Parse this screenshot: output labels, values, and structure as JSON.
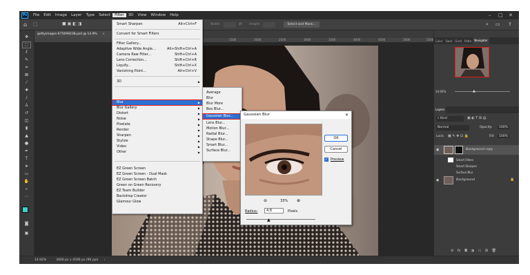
{
  "menubar": {
    "logo": "Ps",
    "items": [
      "File",
      "Edit",
      "Image",
      "Layer",
      "Type",
      "Select",
      "Filter",
      "3D",
      "View",
      "Window",
      "Help"
    ],
    "active_index": 6
  },
  "optbar": {
    "width_label": "Width:",
    "height_label": "Height:",
    "select_mask_label": "Select and Mask..."
  },
  "document": {
    "tab_title": "gettyimages-675699238.psd @ 14.9%",
    "ruler_ticks": [
      "1500",
      "2000",
      "2500",
      "3000",
      "3500",
      "4000",
      "4500",
      "5000",
      "5500"
    ],
    "zoom_status": "14.92%",
    "dimensions_status": "3000 px x 4500 px (96 ppi)"
  },
  "filter_menu": {
    "group1": [
      {
        "label": "Smart Sharpen",
        "shortcut": "Alt+Ctrl+F"
      }
    ],
    "group2": [
      {
        "label": "Convert for Smart Filters",
        "shortcut": ""
      }
    ],
    "group3": [
      {
        "label": "Filter Gallery...",
        "shortcut": ""
      },
      {
        "label": "Adaptive Wide Angle...",
        "shortcut": "Alt+Shift+Ctrl+A"
      },
      {
        "label": "Camera Raw Filter...",
        "shortcut": "Shift+Ctrl+A"
      },
      {
        "label": "Lens Correction...",
        "shortcut": "Shift+Ctrl+R"
      },
      {
        "label": "Liquify...",
        "shortcut": "Shift+Ctrl+X"
      },
      {
        "label": "Vanishing Point...",
        "shortcut": "Alt+Ctrl+V"
      }
    ],
    "group4": [
      {
        "label": "3D"
      }
    ],
    "group5": [
      {
        "label": "Blur"
      },
      {
        "label": "Blur Gallery"
      },
      {
        "label": "Distort"
      },
      {
        "label": "Noise"
      },
      {
        "label": "Pixelate"
      },
      {
        "label": "Render"
      },
      {
        "label": "Sharpen"
      },
      {
        "label": "Stylize"
      },
      {
        "label": "Video"
      },
      {
        "label": "Other"
      }
    ],
    "group6": [
      {
        "label": "EZ Green Screen"
      },
      {
        "label": "EZ Green Screen - Dual Mask"
      },
      {
        "label": "EZ Green Screen Batch"
      },
      {
        "label": "Green on Green Recovery"
      },
      {
        "label": "EZ Team Builder"
      },
      {
        "label": "Backdrop Creator"
      },
      {
        "label": "Glamour Glow"
      }
    ],
    "highlighted": "Blur"
  },
  "blur_menu": {
    "items": [
      "Average",
      "Blur",
      "Blur More",
      "Box Blur...",
      "Gaussian Blur...",
      "Lens Blur...",
      "Motion Blur...",
      "Radial Blur...",
      "Shape Blur...",
      "Smart Blur...",
      "Surface Blur..."
    ],
    "highlighted": "Gaussian Blur..."
  },
  "dialog": {
    "title": "Gaussian Blur",
    "ok_label": "OK",
    "cancel_label": "Cancel",
    "preview_label": "Preview",
    "preview_checked": true,
    "zoom": "33%",
    "radius_label": "Radius:",
    "radius_value": "4.8",
    "radius_unit": "Pixels",
    "radius_slider_fraction": 0.33
  },
  "panels": {
    "top_tabs": [
      "Color",
      "Swat",
      "Grad",
      "Patte",
      "Navigator"
    ],
    "navigator_zoom": "14.92%",
    "layers_tabs": [
      "Layers"
    ],
    "kind_label": "Kind",
    "blend_mode": "Normal",
    "opacity_label": "Opacity:",
    "opacity_value": "100%",
    "lock_label": "Lock:",
    "fill_label": "Fill:",
    "fill_value": "100%",
    "layers": [
      {
        "name": "Background copy"
      },
      {
        "name": "Smart Filters"
      },
      {
        "name": "Smart Sharpen"
      },
      {
        "name": "Surface Blur"
      },
      {
        "name": "Background"
      }
    ]
  },
  "colors": {
    "highlight": "#2e6fd3",
    "annotation_red": "#e01b1b",
    "ps_blue": "#31a8ff"
  }
}
